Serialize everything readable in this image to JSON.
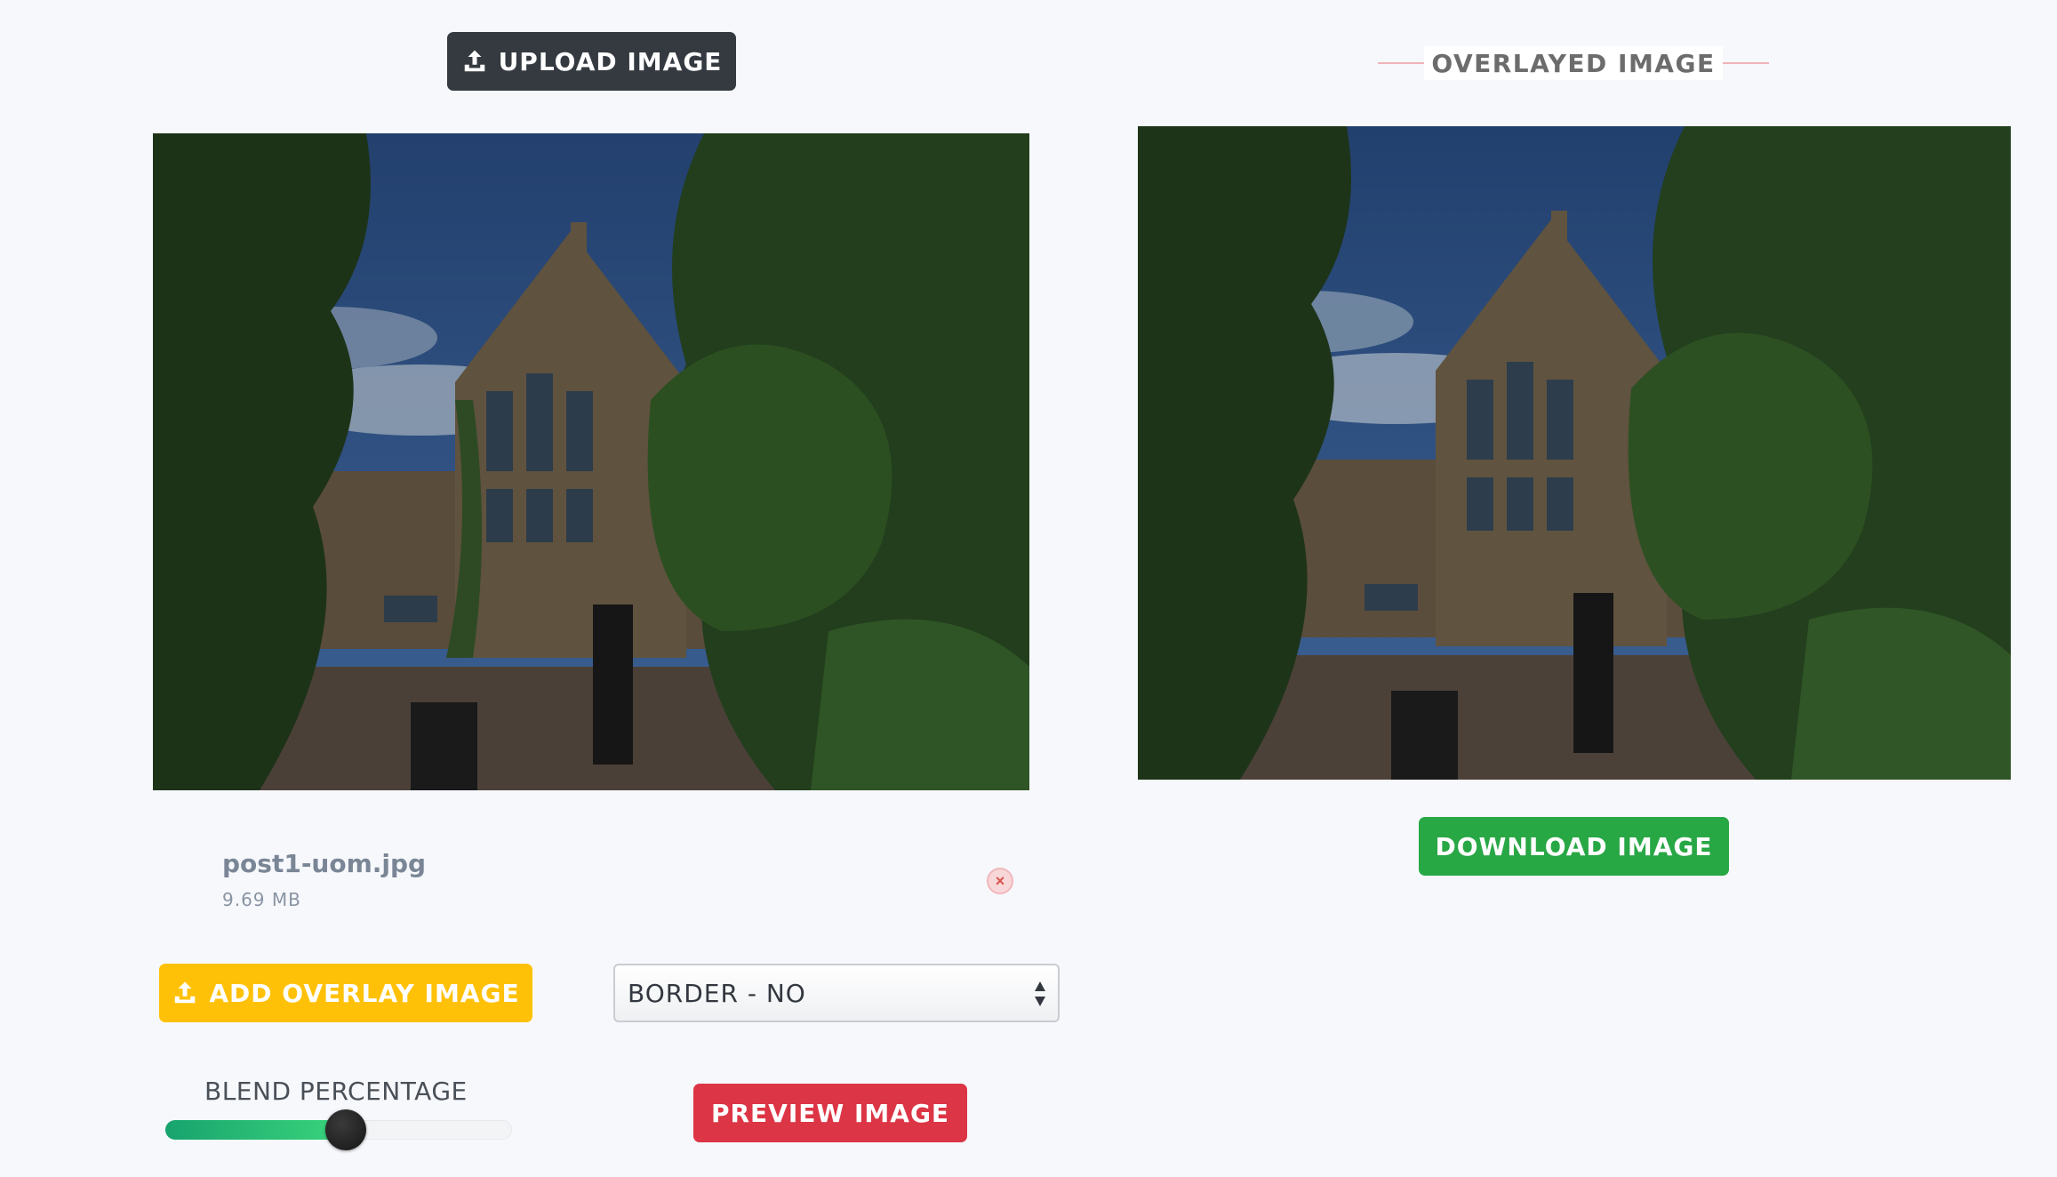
{
  "toolbar": {
    "upload_label": "UPLOAD IMAGE"
  },
  "source_image": {
    "file_name": "post1-uom.jpg",
    "file_size": "9.69 MB"
  },
  "overlay": {
    "add_label": "ADD OVERLAY IMAGE",
    "border_select": {
      "selected": "BORDER - NO"
    },
    "blend": {
      "label": "BLEND PERCENTAGE",
      "value_fraction": 0.52
    },
    "preview_label": "PREVIEW IMAGE"
  },
  "output": {
    "title": "OVERLAYED IMAGE",
    "download_label": "DOWNLOAD IMAGE"
  },
  "icons": {
    "upload": "upload-icon",
    "remove": "close-circle-icon",
    "select_arrows": "select-arrows-icon"
  },
  "colors": {
    "upload_button": "#343a40",
    "overlay_button": "#ffc107",
    "preview_button": "#dc3545",
    "download_button": "#28a745",
    "slider_fill": "#2ecf7c"
  }
}
